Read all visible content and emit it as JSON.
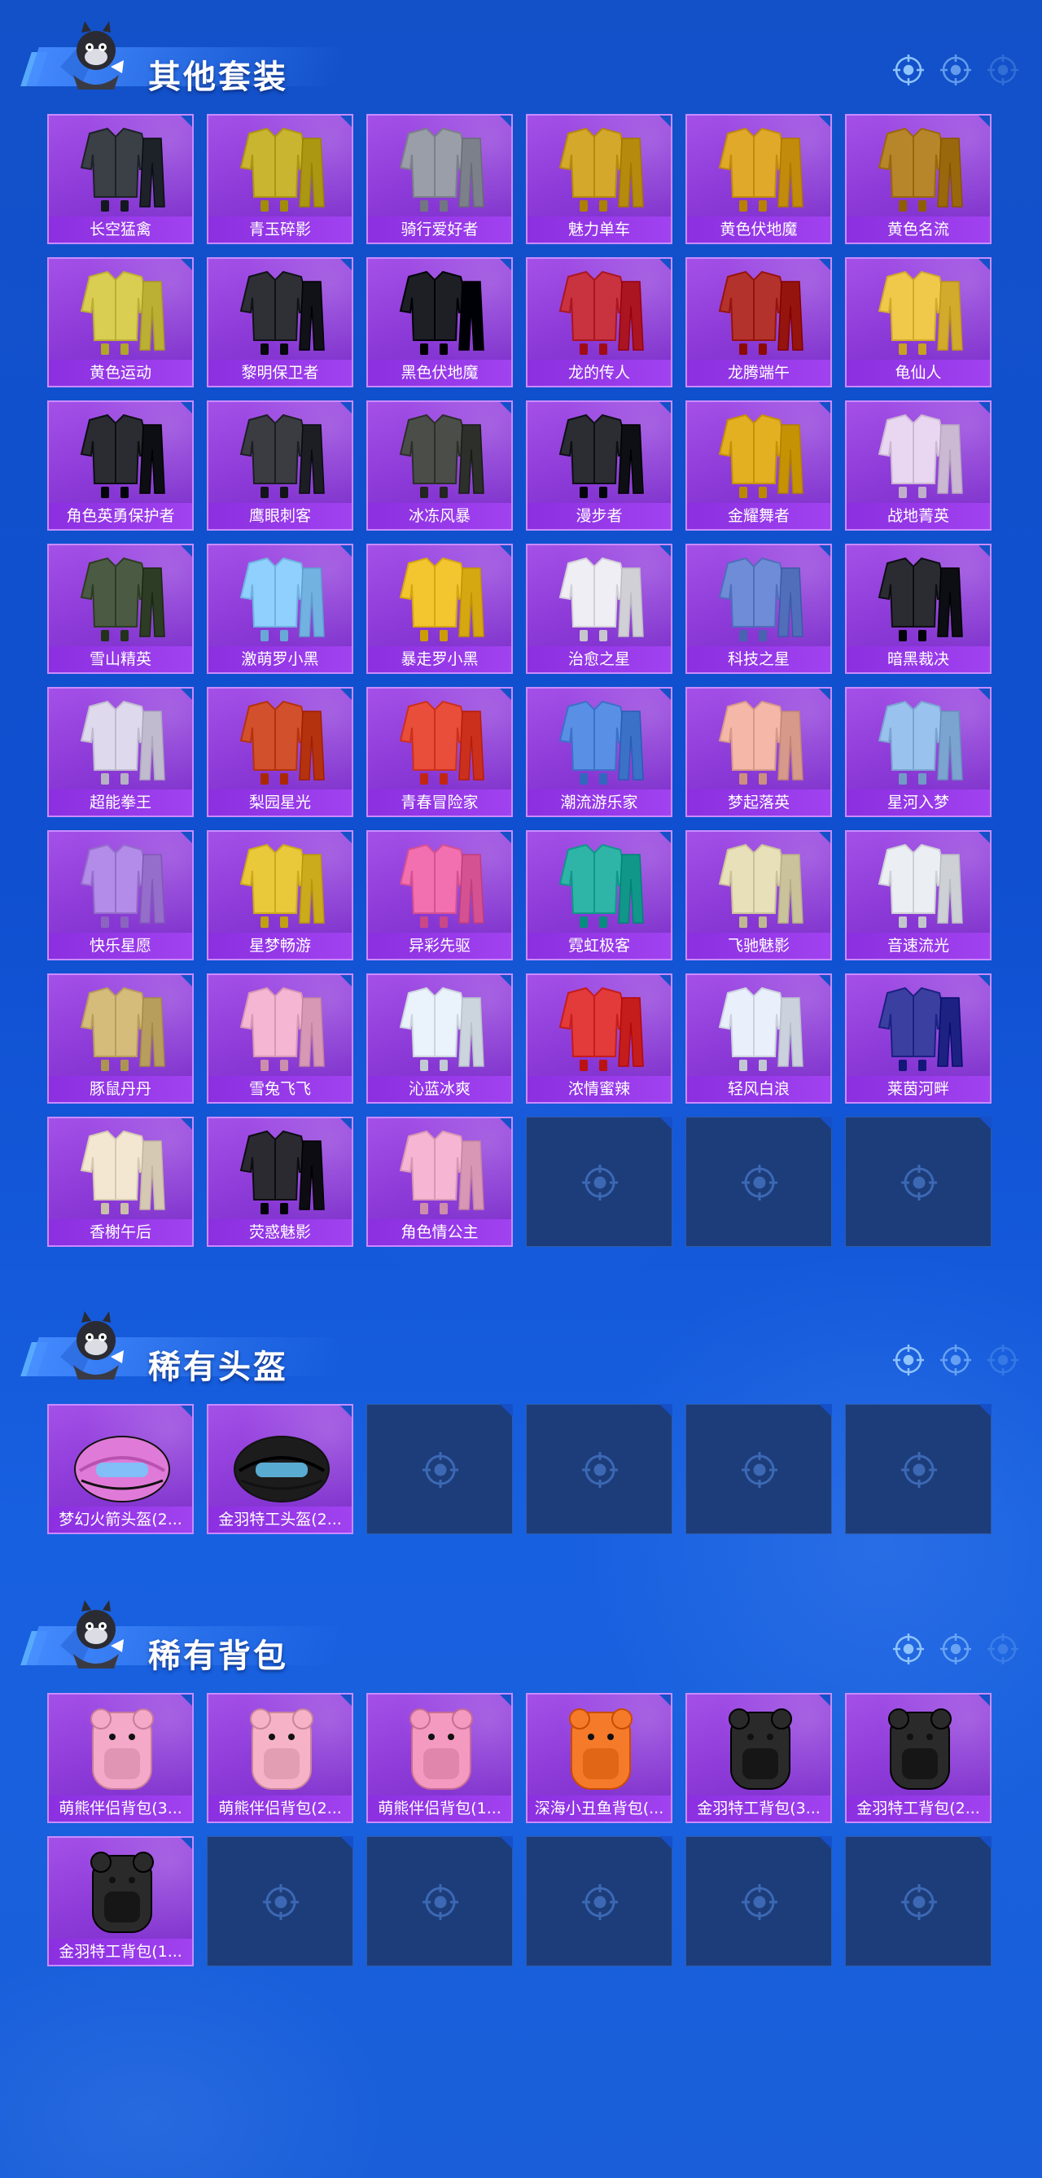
{
  "sections": [
    {
      "title": "其他套装",
      "items": [
        {
          "label": "长空猛禽",
          "icon": "dark-camo-outfit-icon"
        },
        {
          "label": "青玉碎影",
          "icon": "green-yellow-outfit-icon"
        },
        {
          "label": "骑行爱好者",
          "icon": "racer-jacket-outfit-icon"
        },
        {
          "label": "魅力单车",
          "icon": "yellow-shirt-outfit-icon"
        },
        {
          "label": "黄色伏地魔",
          "icon": "yellow-hoodie-outfit-icon"
        },
        {
          "label": "黄色名流",
          "icon": "yellow-suit-outfit-icon"
        },
        {
          "label": "黄色运动",
          "icon": "yellow-sport-outfit-icon"
        },
        {
          "label": "黎明保卫者",
          "icon": "black-leather-outfit-icon"
        },
        {
          "label": "黑色伏地魔",
          "icon": "black-hoodie-outfit-icon"
        },
        {
          "label": "龙的传人",
          "icon": "red-dress-outfit-icon"
        },
        {
          "label": "龙腾端午",
          "icon": "red-jacket-outfit-icon"
        },
        {
          "label": "龟仙人",
          "icon": "yellow-tee-outfit-icon"
        },
        {
          "label": "角色英勇保护者",
          "icon": "armored-robot-outfit-icon"
        },
        {
          "label": "鹰眼刺客",
          "icon": "black-assassin-outfit-icon"
        },
        {
          "label": "冰冻风暴",
          "icon": "gas-mask-outfit-icon"
        },
        {
          "label": "漫步者",
          "icon": "black-walker-outfit-icon"
        },
        {
          "label": "金耀舞者",
          "icon": "gold-dancer-outfit-icon"
        },
        {
          "label": "战地菁英",
          "icon": "striped-outfit-icon"
        },
        {
          "label": "雪山精英",
          "icon": "green-parka-outfit-icon"
        },
        {
          "label": "激萌罗小黑",
          "icon": "cat-pajama-outfit-icon"
        },
        {
          "label": "暴走罗小黑",
          "icon": "yellow-cat-outfit-icon"
        },
        {
          "label": "治愈之星",
          "icon": "white-uniform-outfit-icon"
        },
        {
          "label": "科技之星",
          "icon": "tech-suit-outfit-icon"
        },
        {
          "label": "暗黑裁决",
          "icon": "dark-robe-outfit-icon"
        },
        {
          "label": "超能拳王",
          "icon": "boxer-outfit-icon"
        },
        {
          "label": "梨园星光",
          "icon": "opera-outfit-icon"
        },
        {
          "label": "青春冒险家",
          "icon": "red-adventure-outfit-icon"
        },
        {
          "label": "潮流游乐家",
          "icon": "blue-trend-outfit-icon"
        },
        {
          "label": "梦起落英",
          "icon": "pink-blossom-outfit-icon"
        },
        {
          "label": "星河入梦",
          "icon": "blue-gown-outfit-icon"
        },
        {
          "label": "快乐星愿",
          "icon": "purple-mech-outfit-icon"
        },
        {
          "label": "星梦畅游",
          "icon": "space-outfit-icon"
        },
        {
          "label": "异彩先驱",
          "icon": "colorful-outfit-icon"
        },
        {
          "label": "霓虹极客",
          "icon": "neon-outfit-icon"
        },
        {
          "label": "飞驰魅影",
          "icon": "racing-suit-outfit-icon"
        },
        {
          "label": "音速流光",
          "icon": "white-racing-outfit-icon"
        },
        {
          "label": "豚鼠丹丹",
          "icon": "beige-dress-outfit-icon"
        },
        {
          "label": "雪兔飞飞",
          "icon": "bunny-outfit-icon"
        },
        {
          "label": "沁蓝冰爽",
          "icon": "white-blue-outfit-icon"
        },
        {
          "label": "浓情蜜辣",
          "icon": "red-white-outfit-icon"
        },
        {
          "label": "轻风白浪",
          "icon": "sailor-outfit-icon"
        },
        {
          "label": "莱茵河畔",
          "icon": "plaid-outfit-icon"
        },
        {
          "label": "香榭午后",
          "icon": "cream-coat-outfit-icon"
        },
        {
          "label": "荧惑魅影",
          "icon": "black-frill-outfit-icon"
        },
        {
          "label": "角色情公主",
          "icon": "pink-princess-outfit-icon"
        }
      ],
      "empty_slots": 3
    },
    {
      "title": "稀有头盔",
      "items": [
        {
          "label": "梦幻火箭头盔(2...",
          "icon": "pink-helmet-icon"
        },
        {
          "label": "金羽特工头盔(2...",
          "icon": "black-gold-helmet-icon"
        }
      ],
      "empty_slots": 4
    },
    {
      "title": "稀有背包",
      "items": [
        {
          "label": "萌熊伴侣背包(3...",
          "icon": "pink-bunny-backpack-icon"
        },
        {
          "label": "萌熊伴侣背包(2...",
          "icon": "pink-bear-backpack-icon"
        },
        {
          "label": "萌熊伴侣背包(1...",
          "icon": "pink-bear-small-backpack-icon"
        },
        {
          "label": "深海小丑鱼背包(...",
          "icon": "clownfish-backpack-icon"
        },
        {
          "label": "金羽特工背包(3...",
          "icon": "black-gold-backpack-icon"
        },
        {
          "label": "金羽特工背包(2...",
          "icon": "black-gold-backpack-icon"
        },
        {
          "label": "金羽特工背包(1...",
          "icon": "black-gold-backpack-icon"
        }
      ],
      "empty_slots": 5
    }
  ],
  "colors": {
    "background": "#1351c9",
    "card": "#9a46e4",
    "card_border": "#c98bff",
    "empty": "#1d3d7a"
  }
}
